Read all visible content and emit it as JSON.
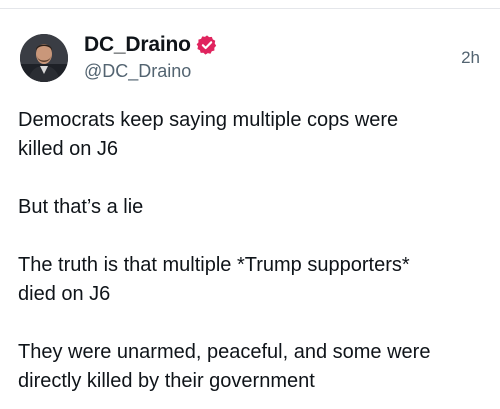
{
  "author": {
    "display_name": "DC_Draino",
    "handle": "@DC_Draino",
    "verified_icon": "verified-badge-icon",
    "verified_color": "#e0245e",
    "avatar_icon": "profile-avatar"
  },
  "timestamp": "2h",
  "post": {
    "lines": {
      "l1": "Democrats keep saying multiple cops were",
      "l2": "killed on J6",
      "l3": "But that’s a lie",
      "l4": "The truth is that multiple *Trump supporters*",
      "l5": "died on J6",
      "l6": "They were unarmed, peaceful, and some were",
      "l7": "directly killed by their government"
    }
  }
}
